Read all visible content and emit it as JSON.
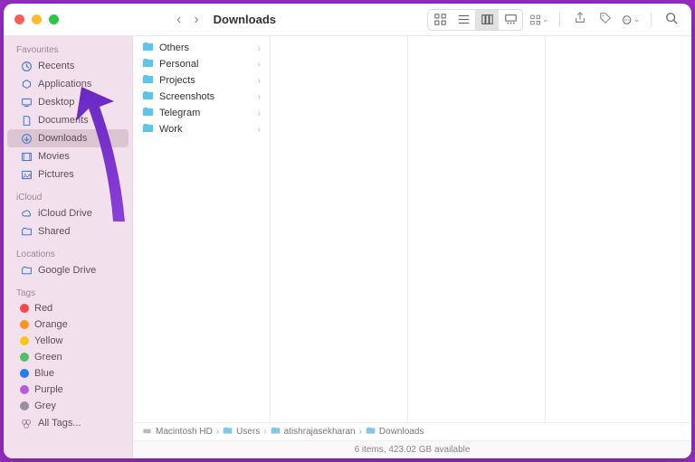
{
  "window": {
    "title": "Downloads"
  },
  "sidebar": {
    "sections": [
      {
        "header": "Favourites",
        "items": [
          {
            "label": "Recents",
            "icon": "clock"
          },
          {
            "label": "Applications",
            "icon": "apps"
          },
          {
            "label": "Desktop",
            "icon": "desktop"
          },
          {
            "label": "Documents",
            "icon": "doc"
          },
          {
            "label": "Downloads",
            "icon": "download",
            "selected": true
          },
          {
            "label": "Movies",
            "icon": "movie"
          },
          {
            "label": "Pictures",
            "icon": "pic"
          }
        ]
      },
      {
        "header": "iCloud",
        "items": [
          {
            "label": "iCloud Drive",
            "icon": "cloud"
          },
          {
            "label": "Shared",
            "icon": "shared"
          }
        ]
      },
      {
        "header": "Locations",
        "items": [
          {
            "label": "Google Drive",
            "icon": "folder"
          }
        ]
      },
      {
        "header": "Tags",
        "items": [
          {
            "label": "Red",
            "color": "#ff3b30"
          },
          {
            "label": "Orange",
            "color": "#ff9500"
          },
          {
            "label": "Yellow",
            "color": "#ffcc00"
          },
          {
            "label": "Green",
            "color": "#34c759"
          },
          {
            "label": "Blue",
            "color": "#007aff"
          },
          {
            "label": "Purple",
            "color": "#af52de"
          },
          {
            "label": "Grey",
            "color": "#8e8e93"
          },
          {
            "label": "All Tags...",
            "icon": "alltags"
          }
        ]
      }
    ]
  },
  "folders": [
    {
      "name": "Others"
    },
    {
      "name": "Personal"
    },
    {
      "name": "Projects"
    },
    {
      "name": "Screenshots"
    },
    {
      "name": "Telegram"
    },
    {
      "name": "Work"
    }
  ],
  "path": [
    "Macintosh HD",
    "Users",
    "atishrajasekharan",
    "Downloads"
  ],
  "status": "6 items, 423.02 GB available"
}
